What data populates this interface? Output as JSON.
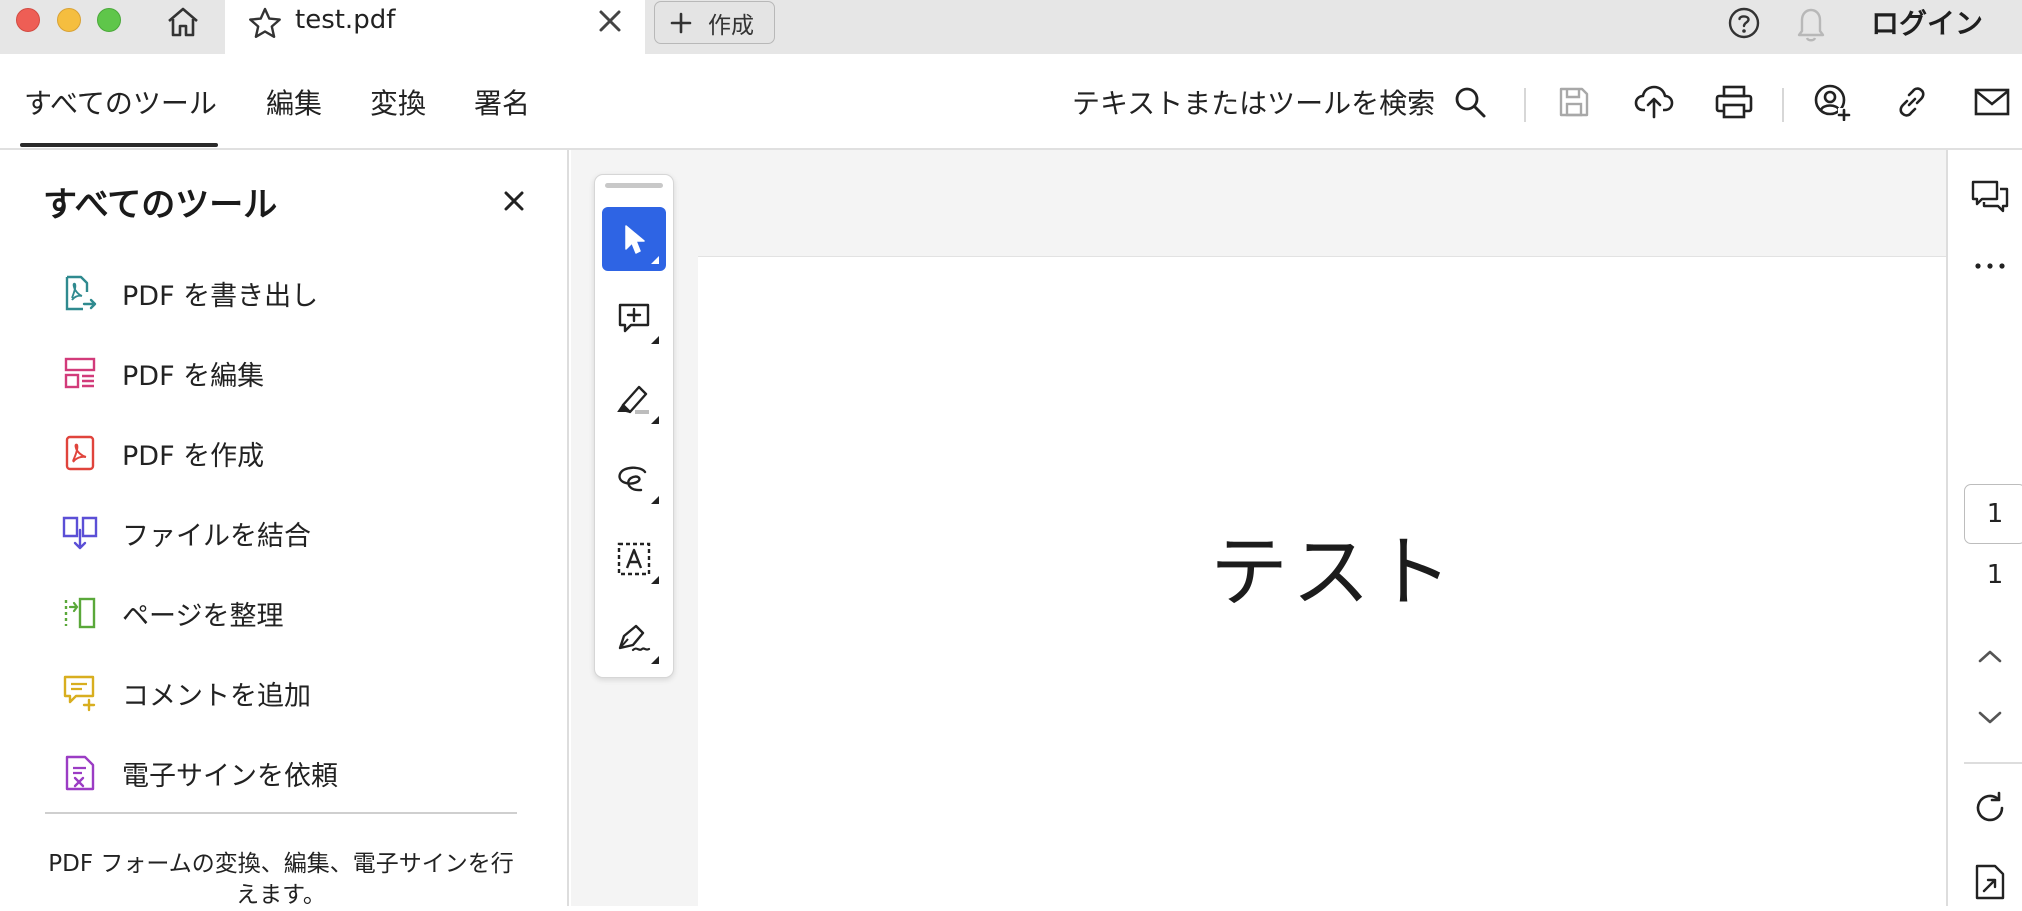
{
  "window": {
    "tab_title": "test.pdf",
    "new_tab_label": "作成",
    "login_label": "ログイン"
  },
  "toolbar": {
    "tabs": [
      {
        "label": "すべてのツール",
        "active": true
      },
      {
        "label": "編集"
      },
      {
        "label": "変換"
      },
      {
        "label": "署名"
      }
    ],
    "search_label": "テキストまたはツールを検索"
  },
  "left_panel": {
    "title": "すべてのツール",
    "tools": [
      {
        "label": "PDF を書き出し",
        "icon": "export-pdf-icon",
        "color": "#2f8a8f"
      },
      {
        "label": "PDF を編集",
        "icon": "edit-pdf-icon",
        "color": "#d23b7a"
      },
      {
        "label": "PDF を作成",
        "icon": "create-pdf-icon",
        "color": "#e0443c"
      },
      {
        "label": "ファイルを結合",
        "icon": "combine-files-icon",
        "color": "#5b4fd6"
      },
      {
        "label": "ページを整理",
        "icon": "organize-pages-icon",
        "color": "#5aa83a"
      },
      {
        "label": "コメントを追加",
        "icon": "add-comment-icon",
        "color": "#d8ae1f"
      },
      {
        "label": "電子サインを依頼",
        "icon": "request-esign-icon",
        "color": "#9b3cc4"
      }
    ],
    "description": "PDF フォームの変換、編集、電子サインを行えます。"
  },
  "document": {
    "text": "テスト"
  },
  "float_tools": [
    {
      "name": "select-tool",
      "icon": "cursor-icon",
      "active": true
    },
    {
      "name": "add-comment-tool",
      "icon": "comment-plus-icon"
    },
    {
      "name": "highlight-tool",
      "icon": "highlighter-icon"
    },
    {
      "name": "draw-tool",
      "icon": "freehand-icon"
    },
    {
      "name": "text-recognition-tool",
      "icon": "text-box-icon"
    },
    {
      "name": "sign-tool",
      "icon": "pen-sign-icon"
    }
  ],
  "right_rail": {
    "current_page": "1",
    "total_pages": "1"
  },
  "colors": {
    "accent": "#2e64e4",
    "titlebar": "#e6e6e6",
    "doc_background": "#f4f4f4"
  }
}
